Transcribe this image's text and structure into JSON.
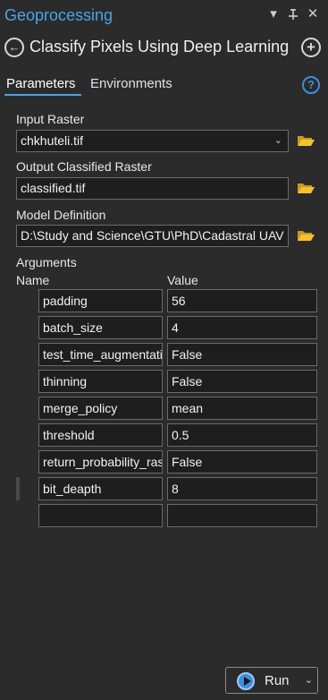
{
  "pane": {
    "title": "Geoprocessing",
    "menu_glyph": "▾",
    "pin_glyph": "⊥",
    "close_glyph": "✕"
  },
  "tool": {
    "back_glyph": "←",
    "title": "Classify Pixels Using Deep Learning",
    "add_glyph": "+"
  },
  "tabs": {
    "parameters": "Parameters",
    "environments": "Environments",
    "help_glyph": "?"
  },
  "params": {
    "input_raster": {
      "label": "Input Raster",
      "value": "chkhuteli.tif",
      "caret": "⌄"
    },
    "output_raster": {
      "label": "Output Classified Raster",
      "value": "classified.tif"
    },
    "model_definition": {
      "label": "Model Definition",
      "value": "D:\\Study and Science\\GTU\\PhD\\Cadastral UAV"
    }
  },
  "arguments": {
    "label": "Arguments",
    "col_name": "Name",
    "col_value": "Value",
    "rows": [
      {
        "name": "padding",
        "value": "56"
      },
      {
        "name": "batch_size",
        "value": "4"
      },
      {
        "name": "test_time_augmentation",
        "value": "False"
      },
      {
        "name": "thinning",
        "value": "False"
      },
      {
        "name": "merge_policy",
        "value": "mean"
      },
      {
        "name": "threshold",
        "value": "0.5"
      },
      {
        "name": "return_probability_raster",
        "value": "False"
      },
      {
        "name": "bit_deapth",
        "value": "8"
      },
      {
        "name": "",
        "value": ""
      }
    ]
  },
  "run": {
    "label": "Run",
    "caret": "⌄"
  },
  "colors": {
    "accent": "#4aa3e6",
    "background": "#2b2b2b",
    "field_bg": "#1e1e1e",
    "folder": "#f2c230"
  }
}
